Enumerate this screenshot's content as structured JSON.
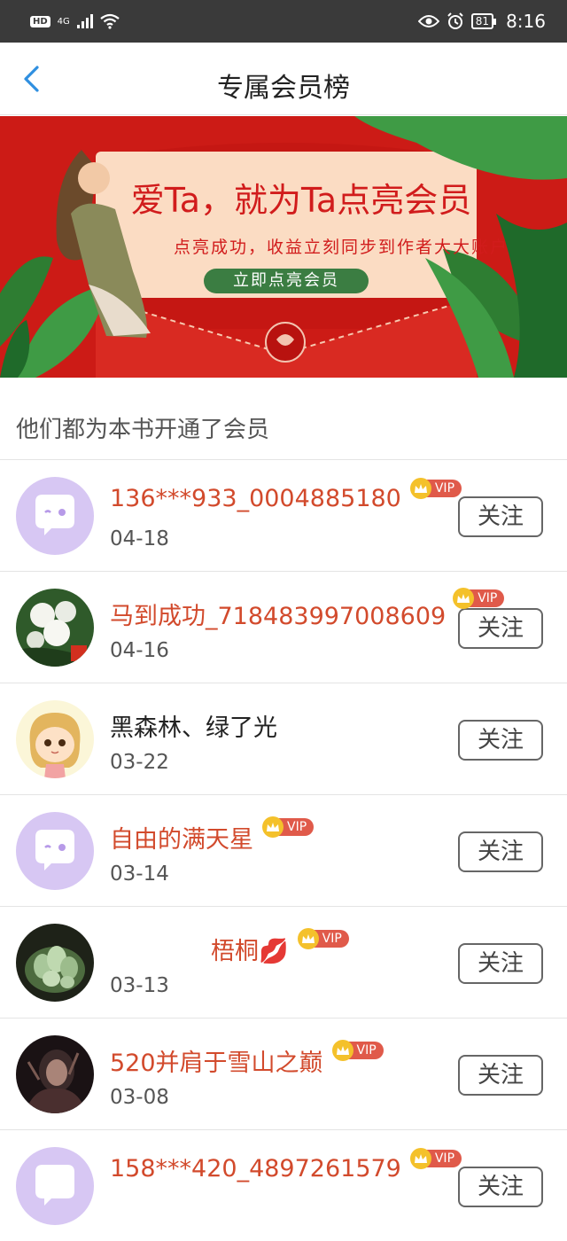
{
  "status_bar": {
    "network": "4G",
    "battery": "81",
    "time": "8:16"
  },
  "header": {
    "title": "专属会员榜"
  },
  "banner": {
    "headline": "爱Ta，就为Ta点亮会员",
    "subline": "点亮成功，收益立刻同步到作者大大账户",
    "button_label": "立即点亮会员"
  },
  "section_title": "他们都为本书开通了会员",
  "vip_label": "VIP",
  "follow_label": "关注",
  "members": [
    {
      "name": "136***933_0004885180",
      "date": "04-18",
      "vip": true,
      "avatar": "default-avatar"
    },
    {
      "name": "马到成功_718483997008609",
      "date": "04-16",
      "vip": true,
      "avatar": "flowers-photo"
    },
    {
      "name": "黑森林、绿了光",
      "date": "03-22",
      "vip": false,
      "avatar": "cartoon-girl"
    },
    {
      "name": "自由的满天星",
      "date": "03-14",
      "vip": true,
      "avatar": "default-avatar"
    },
    {
      "name": "梧桐💋",
      "date": "03-13",
      "vip": true,
      "avatar": "succulent-photo"
    },
    {
      "name": "520并肩于雪山之巅",
      "date": "03-08",
      "vip": true,
      "avatar": "dark-portrait"
    },
    {
      "name": "158***420_4897261579",
      "date": "",
      "vip": true,
      "avatar": "default-avatar"
    }
  ],
  "colors": {
    "accent_name": "#d24a2c",
    "banner_red": "#cc1b16",
    "banner_green": "#3b7d42",
    "back_blue": "#2f8fe0"
  }
}
